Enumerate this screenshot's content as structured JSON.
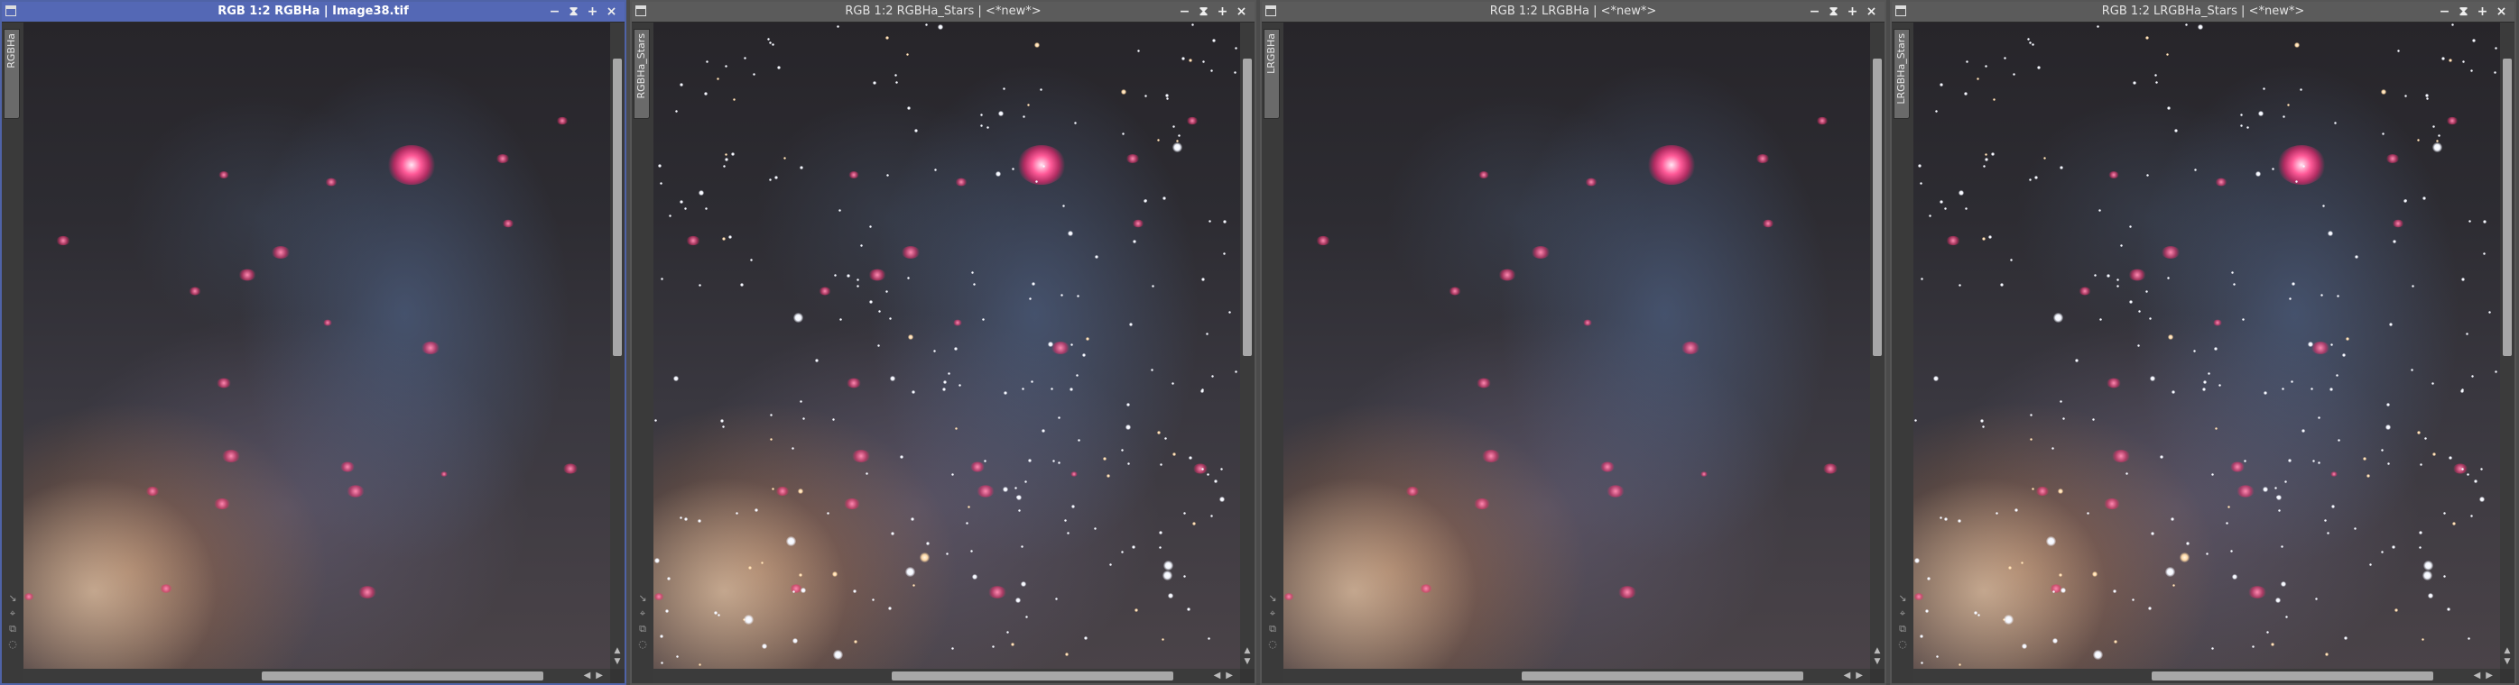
{
  "windows": [
    {
      "id": "w1",
      "title": "RGB 1:2 RGBHa | Image38.tif",
      "tab_label": "RGBHa",
      "active": true,
      "stars": false
    },
    {
      "id": "w2",
      "title": "RGB 1:2 RGBHa_Stars | <*new*>",
      "tab_label": "RGBHa_Stars",
      "active": false,
      "stars": true
    },
    {
      "id": "w3",
      "title": "RGB 1:2 LRGBHa | <*new*>",
      "tab_label": "LRGBHa",
      "active": false,
      "stars": false
    },
    {
      "id": "w4",
      "title": "RGB 1:2 LRGBHa_Stars | <*new*>",
      "tab_label": "LRGBHa_Stars",
      "active": false,
      "stars": true
    }
  ],
  "icons": {
    "minimize": "−",
    "shade": "⧗",
    "maximize": "+",
    "close": "×",
    "scroll_up": "▲",
    "scroll_down": "▼",
    "scroll_left": "◀",
    "scroll_right": "▶",
    "tools": [
      "↘",
      "⌖",
      "⧉",
      "◌"
    ]
  },
  "colors": {
    "active_titlebar": "#5468b5",
    "inactive_titlebar": "#5b5b5b",
    "nebula": "#ff5a98"
  }
}
